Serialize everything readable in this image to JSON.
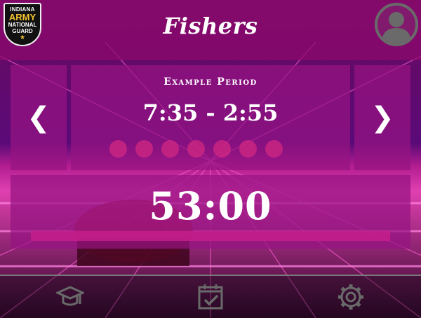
{
  "header": {
    "title": "Fishers",
    "logo": {
      "line1": "INDIANA",
      "line2": "ARMY",
      "line3": "NATIONAL",
      "line4": "GUARD",
      "star": "★"
    },
    "avatar_icon": "user-avatar-icon"
  },
  "schedule": {
    "prev_label": "❮",
    "next_label": "❯",
    "period_name": "Example Period",
    "period_time": "7:35 - 2:55",
    "page_dots": 7
  },
  "timer": {
    "countdown": "53:00",
    "progress_fraction": 0.0
  },
  "footer": {
    "icons": [
      "graduation-cap-icon",
      "calendar-check-icon",
      "gear-icon"
    ]
  },
  "colors": {
    "accent": "#c0208a",
    "card": "#96147e",
    "dot": "#d22882"
  }
}
